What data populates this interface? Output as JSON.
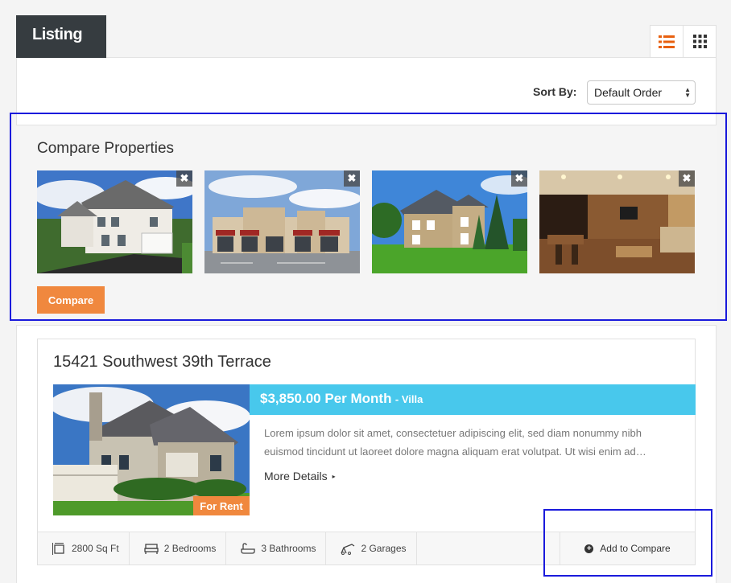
{
  "header": {
    "title": "Listing"
  },
  "view_toggle": {
    "list_icon": "list-view-icon",
    "grid_icon": "grid-view-icon",
    "accent": "#e8600f"
  },
  "sort": {
    "label": "Sort By:",
    "value": "Default Order"
  },
  "compare": {
    "title": "Compare Properties",
    "button_label": "Compare",
    "remove_glyph": "✖",
    "thumbnails": [
      {
        "icon": "house-photo"
      },
      {
        "icon": "commercial-building-photo"
      },
      {
        "icon": "stone-house-photo"
      },
      {
        "icon": "living-room-photo"
      }
    ]
  },
  "property": {
    "title": "15421 Southwest 39th Terrace",
    "price": "$3,850.00 Per Month",
    "type": "- Villa",
    "badge": "For Rent",
    "description": "Lorem ipsum dolor sit amet, consectetuer adipiscing elit, sed diam nonummy nibh euismod tincidunt ut laoreet dolore magna aliquam erat volutpat. Ut wisi enim ad…",
    "more_details": "More Details",
    "more_caret": "▸",
    "features": [
      {
        "icon": "area-icon",
        "label": "2800 Sq Ft"
      },
      {
        "icon": "bed-icon",
        "label": "2 Bedrooms"
      },
      {
        "icon": "bathtub-icon",
        "label": "3 Bathrooms"
      },
      {
        "icon": "garage-icon",
        "label": "2 Garages"
      }
    ],
    "add_to_compare": "Add to Compare",
    "add_glyph": "+"
  },
  "colors": {
    "orange": "#f0883e",
    "cyan": "#48c8ec",
    "dark": "#363c40",
    "highlight": "#1a1adc"
  }
}
